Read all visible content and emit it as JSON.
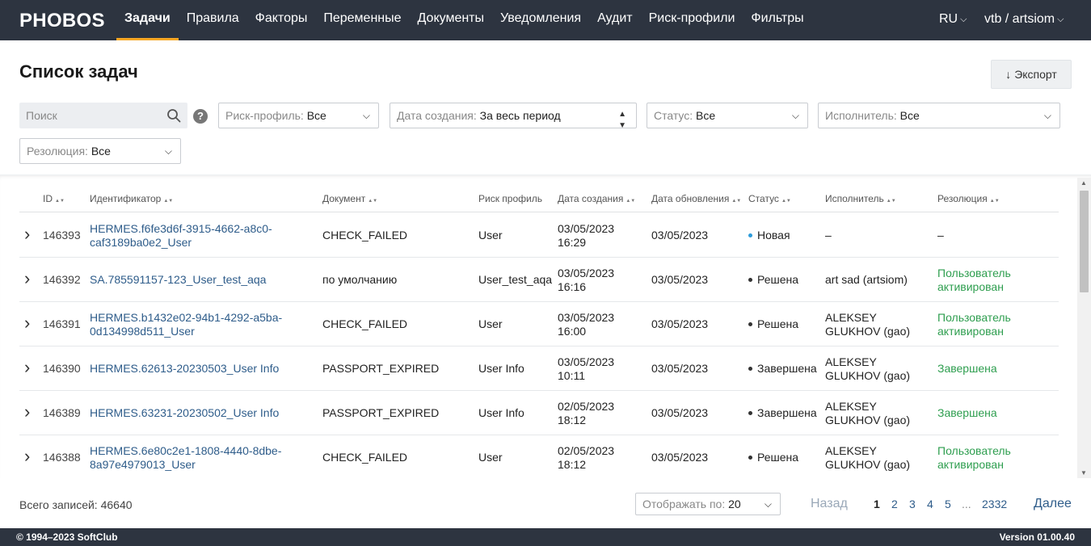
{
  "app": {
    "logo": "PHOBOS"
  },
  "nav": {
    "items": [
      "Задачи",
      "Правила",
      "Факторы",
      "Переменные",
      "Документы",
      "Уведомления",
      "Аудит",
      "Риск-профили",
      "Фильтры"
    ],
    "active": "Задачи",
    "accent_color": "#f5a623"
  },
  "header_right": {
    "lang": "RU",
    "user": "vtb / artsiom"
  },
  "page": {
    "title": "Список задач",
    "export_label": "Экспорт",
    "export_icon": "arrow-down-icon"
  },
  "filters": {
    "search_placeholder": "Поиск",
    "help_label": "?",
    "risk_profile": {
      "label": "Риск-профиль:",
      "value": "Все"
    },
    "date_created": {
      "label": "Дата создания:",
      "value": "За весь период"
    },
    "status": {
      "label": "Статус:",
      "value": "Все"
    },
    "assignee": {
      "label": "Исполнитель:",
      "value": "Все"
    },
    "resolution": {
      "label": "Резолюция:",
      "value": "Все"
    }
  },
  "table": {
    "columns": [
      "ID",
      "Идентификатор",
      "Документ",
      "Риск профиль",
      "Дата создания",
      "Дата обновления",
      "Статус",
      "Исполнитель",
      "Резолюция"
    ],
    "rows": [
      {
        "id": "146393",
        "identifier": "HERMES.f6fe3d6f-3915-4662-a8c0-caf3189ba0e2_User",
        "document": "CHECK_FAILED",
        "risk_profile": "User",
        "created_date": "03/05/2023",
        "created_time": "16:29",
        "updated": "03/05/2023",
        "status": "Новая",
        "assignee": "–",
        "resolution": "–"
      },
      {
        "id": "146392",
        "identifier": "SA.785591157-123_User_test_aqa",
        "document": "по умолчанию",
        "risk_profile": "User_test_aqa",
        "created_date": "03/05/2023",
        "created_time": "16:16",
        "updated": "03/05/2023",
        "status": "Решена",
        "assignee": "art sad (artsiom)",
        "resolution": "Пользователь активирован"
      },
      {
        "id": "146391",
        "identifier": "HERMES.b1432e02-94b1-4292-a5ba-0d134998d511_User",
        "document": "CHECK_FAILED",
        "risk_profile": "User",
        "created_date": "03/05/2023",
        "created_time": "16:00",
        "updated": "03/05/2023",
        "status": "Решена",
        "assignee": "ALEKSEY GLUKHOV (gao)",
        "resolution": "Пользователь активирован"
      },
      {
        "id": "146390",
        "identifier": "HERMES.62613-20230503_User Info",
        "document": "PASSPORT_EXPIRED",
        "risk_profile": "User Info",
        "created_date": "03/05/2023",
        "created_time": "10:11",
        "updated": "03/05/2023",
        "status": "Завершена",
        "assignee": "ALEKSEY GLUKHOV (gao)",
        "resolution": "Завершена"
      },
      {
        "id": "146389",
        "identifier": "HERMES.63231-20230502_User Info",
        "document": "PASSPORT_EXPIRED",
        "risk_profile": "User Info",
        "created_date": "02/05/2023",
        "created_time": "18:12",
        "updated": "03/05/2023",
        "status": "Завершена",
        "assignee": "ALEKSEY GLUKHOV (gao)",
        "resolution": "Завершена"
      },
      {
        "id": "146388",
        "identifier": "HERMES.6e80c2e1-1808-4440-8dbe-8a97e4979013_User",
        "document": "CHECK_FAILED",
        "risk_profile": "User",
        "created_date": "02/05/2023",
        "created_time": "18:12",
        "updated": "03/05/2023",
        "status": "Решена",
        "assignee": "ALEKSEY GLUKHOV (gao)",
        "resolution": "Пользователь активирован"
      }
    ],
    "status_colors": {
      "Новая": "#2d9cdb",
      "Решена": "#333333",
      "Завершена": "#333333"
    },
    "resolution_color": "#2e9e4f",
    "link_color": "#2e5c8a"
  },
  "footer": {
    "total_label": "Всего записей:",
    "total_value": "46640",
    "per_page_label": "Отображать по:",
    "per_page_value": "20",
    "prev": "Назад",
    "next": "Далее",
    "pages": [
      "1",
      "2",
      "3",
      "4",
      "5",
      "...",
      "2332"
    ],
    "current_page": "1"
  },
  "bottombar": {
    "copyright": "© 1994–2023 SoftClub",
    "version": "Version 01.00.40"
  }
}
